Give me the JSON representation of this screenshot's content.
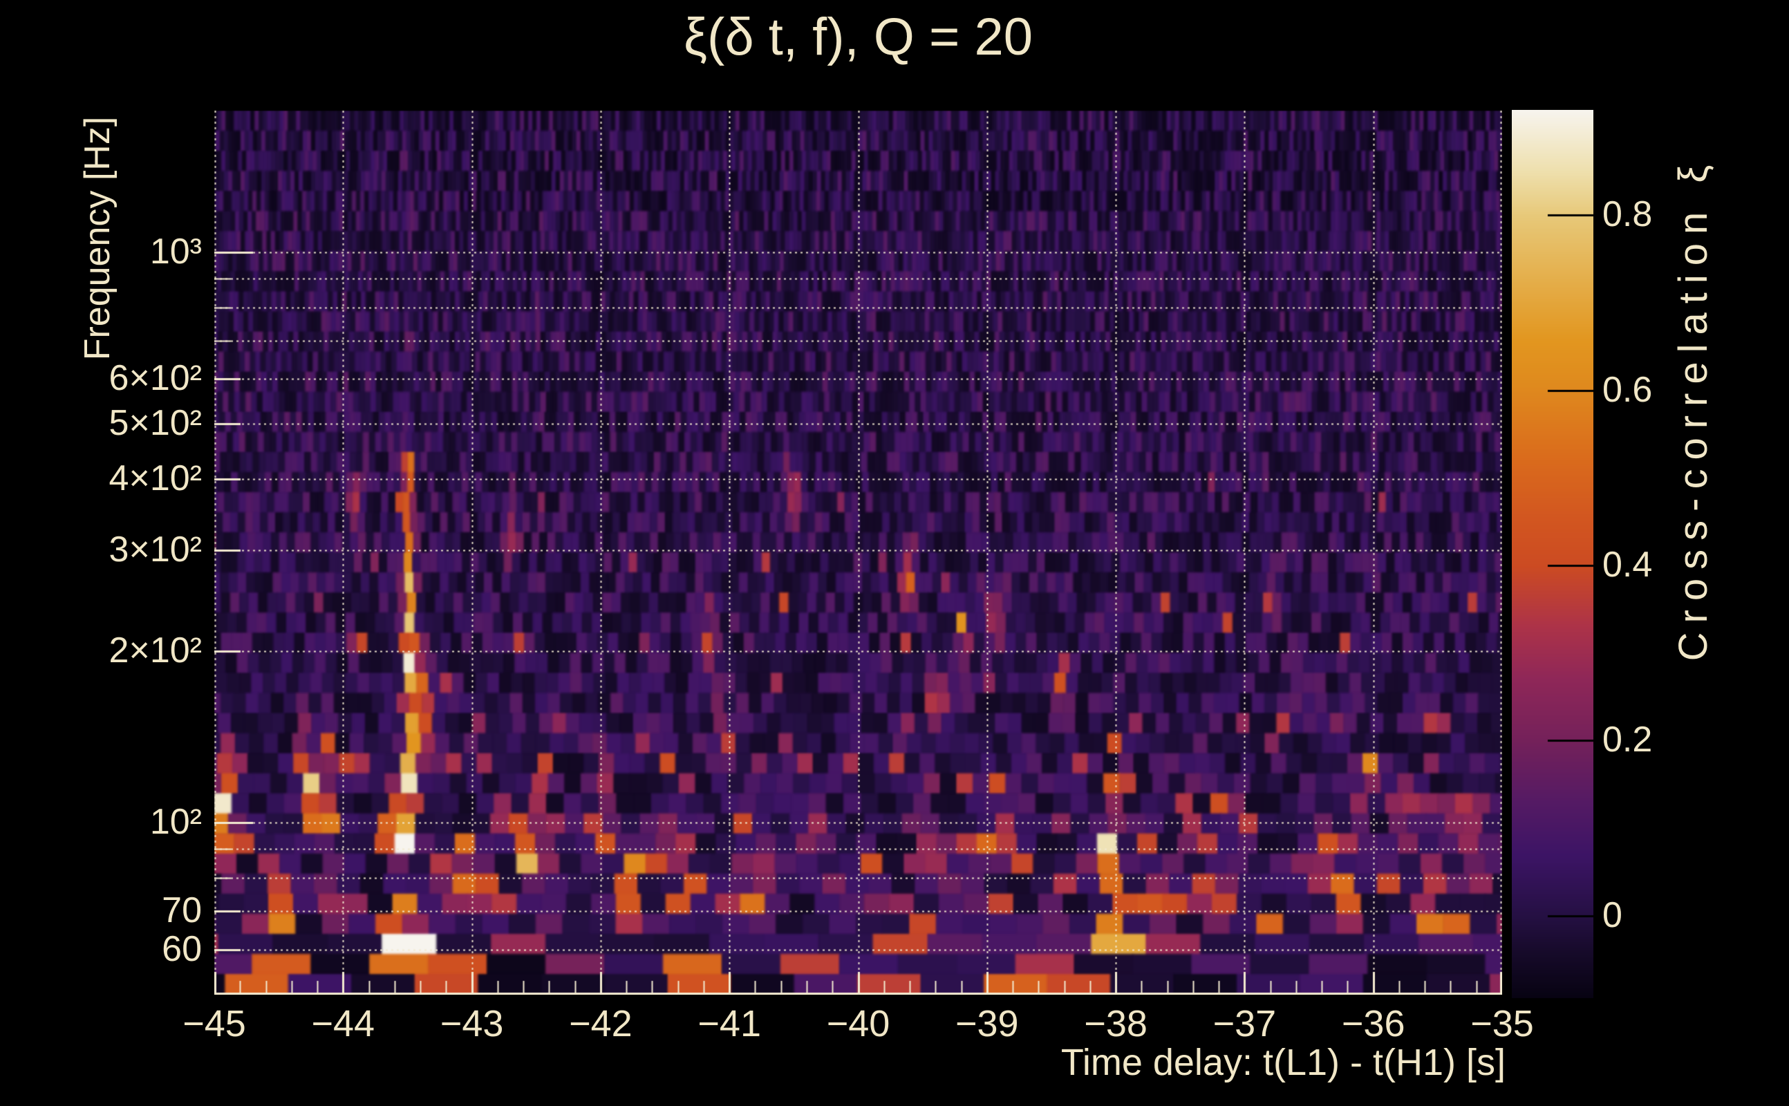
{
  "title": "ξ(δ t, f), Q = 20",
  "colors": {
    "background": "#000000",
    "text": "#f1e7c7",
    "grid": "#f3ead0",
    "axis": "#f3ead0",
    "colorbar_tick": "#000000",
    "colormap_stops": [
      [
        0.0,
        "#070312"
      ],
      [
        0.05,
        "#160a29"
      ],
      [
        0.093,
        "#251043"
      ],
      [
        0.16,
        "#3c1465"
      ],
      [
        0.22,
        "#541a64"
      ],
      [
        0.29,
        "#74215a"
      ],
      [
        0.36,
        "#8f2758"
      ],
      [
        0.42,
        "#ad3348"
      ],
      [
        0.487,
        "#cc4b22"
      ],
      [
        0.54,
        "#d25620"
      ],
      [
        0.61,
        "#da6c1c"
      ],
      [
        0.69,
        "#df8a1e"
      ],
      [
        0.74,
        "#e2961f"
      ],
      [
        0.8,
        "#e4ab45"
      ],
      [
        0.88,
        "#e7c878"
      ],
      [
        0.93,
        "#eedfac"
      ],
      [
        1.0,
        "#f7f4ee"
      ]
    ]
  },
  "axes": {
    "x": {
      "title": "Time delay: t(L1) - t(H1) [s]",
      "min": -45,
      "max": -35,
      "minor_step": 0.2,
      "major_ticks": [
        {
          "t": -45,
          "label": "−45"
        },
        {
          "t": -44,
          "label": "−44"
        },
        {
          "t": -43,
          "label": "−43"
        },
        {
          "t": -42,
          "label": "−42"
        },
        {
          "t": -41,
          "label": "−41"
        },
        {
          "t": -40,
          "label": "−40"
        },
        {
          "t": -39,
          "label": "−39"
        },
        {
          "t": -38,
          "label": "−38"
        },
        {
          "t": -37,
          "label": "−37"
        },
        {
          "t": -36,
          "label": "−36"
        },
        {
          "t": -35,
          "label": "−35"
        }
      ]
    },
    "y": {
      "title": "Frequency [Hz]",
      "min": 50,
      "max": 1770,
      "scale": "log",
      "ticks": [
        {
          "f": 1000,
          "label": "10³",
          "size": "major"
        },
        {
          "f": 900,
          "label": "",
          "size": "minor"
        },
        {
          "f": 800,
          "label": "",
          "size": "minor"
        },
        {
          "f": 700,
          "label": "",
          "size": "minor"
        },
        {
          "f": 600,
          "label": "6×10²",
          "size": "mid"
        },
        {
          "f": 500,
          "label": "5×10²",
          "size": "mid"
        },
        {
          "f": 400,
          "label": "4×10²",
          "size": "mid"
        },
        {
          "f": 300,
          "label": "3×10²",
          "size": "mid"
        },
        {
          "f": 200,
          "label": "2×10²",
          "size": "mid"
        },
        {
          "f": 100,
          "label": "10²",
          "size": "major"
        },
        {
          "f": 90,
          "label": "",
          "size": "minor"
        },
        {
          "f": 80,
          "label": "",
          "size": "minor"
        },
        {
          "f": 70,
          "label": "70",
          "size": "mid"
        },
        {
          "f": 60,
          "label": "60",
          "size": "mid"
        }
      ]
    }
  },
  "colorbar": {
    "title": "Cross-correlation ξ",
    "min": -0.094,
    "max": 0.92,
    "ticks": [
      {
        "v": 0.8,
        "label": "0.8"
      },
      {
        "v": 0.6,
        "label": "0.6"
      },
      {
        "v": 0.4,
        "label": "0.4"
      },
      {
        "v": 0.2,
        "label": "0.2"
      },
      {
        "v": 0.0,
        "label": "0"
      }
    ]
  },
  "chart_data": {
    "type": "heatmap",
    "title": "ξ(δ t, f), Q = 20",
    "xlabel": "Time delay: t(L1) - t(H1) [s]",
    "ylabel": "Frequency [Hz]",
    "x_range": [
      -45,
      -35
    ],
    "f_range": [
      50,
      1770
    ],
    "value_range": [
      -0.094,
      0.92
    ],
    "grid_freqs": [
      1000,
      900,
      800,
      700,
      600,
      500,
      400,
      300,
      200,
      100,
      90,
      80,
      70,
      60
    ],
    "grid_delays": [
      -45,
      -44,
      -43,
      -42,
      -41,
      -40,
      -39,
      -38,
      -37,
      -36,
      -35
    ],
    "noise": {
      "seed": 12,
      "rows": 44,
      "base_min": -0.055,
      "base_span": 0.2
    },
    "streak": {
      "t": -43.49,
      "st": 0.032,
      "segments": [
        [
          50,
          62,
          0.95
        ],
        [
          62,
          115,
          0.9
        ],
        [
          115,
          285,
          0.8
        ],
        [
          285,
          340,
          0.5
        ],
        [
          340,
          445,
          0.5
        ],
        [
          445,
          1770,
          0.04
        ]
      ]
    },
    "features": [
      {
        "t": -44.95,
        "f": 105,
        "xi": 0.48
      },
      {
        "t": -44.88,
        "f": 95,
        "xi": 0.4
      },
      {
        "t": -44.9,
        "f": 125,
        "xi": 0.3
      },
      {
        "t": -44.62,
        "f": 62,
        "xi": 0.48
      },
      {
        "t": -44.47,
        "f": 60,
        "xi": 0.44
      },
      {
        "t": -44.3,
        "f": 128,
        "xi": 0.5
      },
      {
        "t": -44.22,
        "f": 112,
        "xi": 0.45
      },
      {
        "t": -44.12,
        "f": 104,
        "xi": 0.4
      },
      {
        "t": -44.05,
        "f": 72,
        "xi": 0.26
      },
      {
        "t": -43.9,
        "f": 350,
        "xi": 0.26
      },
      {
        "t": -43.62,
        "f": 92,
        "xi": 0.3
      },
      {
        "t": -43.37,
        "f": 178,
        "xi": 0.42
      },
      {
        "t": -43.35,
        "f": 135,
        "xi": 0.34
      },
      {
        "t": -43.28,
        "f": 82,
        "xi": 0.36
      },
      {
        "t": -43.12,
        "f": 78,
        "xi": 0.32
      },
      {
        "t": -42.86,
        "f": 76,
        "xi": 0.34
      },
      {
        "t": -42.7,
        "f": 320,
        "xi": 0.24
      },
      {
        "t": -42.56,
        "f": 92,
        "xi": 0.46
      },
      {
        "t": -42.45,
        "f": 85,
        "xi": 0.36
      },
      {
        "t": -42.3,
        "f": 64,
        "xi": 0.28
      },
      {
        "t": -42.02,
        "f": 95,
        "xi": 0.36
      },
      {
        "t": -41.97,
        "f": 125,
        "xi": 0.28
      },
      {
        "t": -41.78,
        "f": 80,
        "xi": 0.46
      },
      {
        "t": -41.71,
        "f": 70,
        "xi": 0.4
      },
      {
        "t": -41.45,
        "f": 95,
        "xi": 0.38
      },
      {
        "t": -41.34,
        "f": 88,
        "xi": 0.3
      },
      {
        "t": -41.15,
        "f": 210,
        "xi": 0.28
      },
      {
        "t": -41.05,
        "f": 140,
        "xi": 0.36
      },
      {
        "t": -40.95,
        "f": 90,
        "xi": 0.28
      },
      {
        "t": -40.75,
        "f": 85,
        "xi": 0.34
      },
      {
        "t": -40.62,
        "f": 80,
        "xi": 0.3
      },
      {
        "t": -40.5,
        "f": 380,
        "xi": 0.24
      },
      {
        "t": -40.35,
        "f": 95,
        "xi": 0.33
      },
      {
        "t": -40.18,
        "f": 75,
        "xi": 0.28
      },
      {
        "t": -39.9,
        "f": 82,
        "xi": 0.3
      },
      {
        "t": -39.61,
        "f": 270,
        "xi": 0.42
      },
      {
        "t": -39.5,
        "f": 90,
        "xi": 0.4
      },
      {
        "t": -39.38,
        "f": 160,
        "xi": 0.38
      },
      {
        "t": -39.36,
        "f": 82,
        "xi": 0.32
      },
      {
        "t": -39.18,
        "f": 215,
        "xi": 0.3
      },
      {
        "t": -39.05,
        "f": 75,
        "xi": 0.28
      },
      {
        "t": -38.93,
        "f": 235,
        "xi": 0.3
      },
      {
        "t": -38.85,
        "f": 95,
        "xi": 0.42
      },
      {
        "t": -38.55,
        "f": 62,
        "xi": 0.38
      },
      {
        "t": -38.42,
        "f": 172,
        "xi": 0.34
      },
      {
        "t": -38.05,
        "f": 95,
        "xi": 0.55
      },
      {
        "t": -38.0,
        "f": 80,
        "xi": 0.52
      },
      {
        "t": -37.97,
        "f": 62,
        "xi": 0.55
      },
      {
        "t": -37.88,
        "f": 57,
        "xi": 0.45
      },
      {
        "t": -37.7,
        "f": 72,
        "xi": 0.48
      },
      {
        "t": -37.55,
        "f": 67,
        "xi": 0.52
      },
      {
        "t": -37.45,
        "f": 100,
        "xi": 0.34
      },
      {
        "t": -37.3,
        "f": 70,
        "xi": 0.46
      },
      {
        "t": -37.17,
        "f": 76,
        "xi": 0.38
      },
      {
        "t": -36.8,
        "f": 250,
        "xi": 0.24
      },
      {
        "t": -36.55,
        "f": 85,
        "xi": 0.28
      },
      {
        "t": -36.4,
        "f": 87,
        "xi": 0.33
      },
      {
        "t": -36.2,
        "f": 72,
        "xi": 0.32
      },
      {
        "t": -36.05,
        "f": 115,
        "xi": 0.42
      },
      {
        "t": -35.72,
        "f": 102,
        "xi": 0.38
      },
      {
        "t": -35.5,
        "f": 87,
        "xi": 0.4
      },
      {
        "t": -35.32,
        "f": 72,
        "xi": 0.32
      },
      {
        "t": -35.15,
        "f": 95,
        "xi": 0.3
      },
      {
        "t": -43.52,
        "f": 54,
        "xi": 0.6,
        "st": 0.07,
        "slf": 0.05
      }
    ]
  }
}
